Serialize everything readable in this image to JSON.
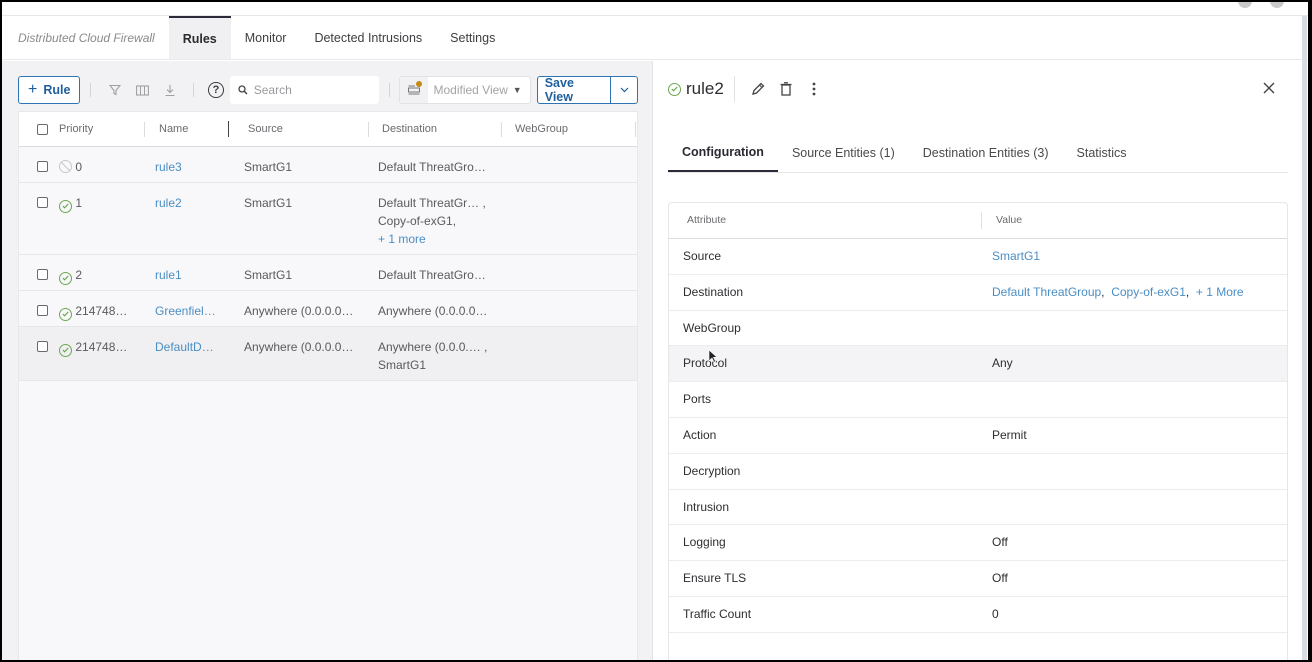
{
  "app": {
    "brand": "Distributed Cloud Firewall",
    "nav_tabs": [
      {
        "label": "Rules",
        "active": true
      },
      {
        "label": "Monitor",
        "active": false
      },
      {
        "label": "Detected Intrusions",
        "active": false
      },
      {
        "label": "Settings",
        "active": false
      }
    ]
  },
  "toolbar": {
    "add_rule_label": "Rule",
    "search_placeholder": "Search",
    "view_select_value": "Modified View",
    "save_view_label": "Save View",
    "icons": [
      "filter-icon",
      "columns-icon",
      "download-icon",
      "help-icon"
    ]
  },
  "rules_table": {
    "columns": [
      "Priority",
      "Name",
      "Source",
      "Destination",
      "WebGroup"
    ],
    "rows": [
      {
        "status": "disabled",
        "priority": "0",
        "name": "rule3",
        "source": "SmartG1",
        "destination": [
          "Default ThreatGro…"
        ],
        "more": "",
        "webgroup": ""
      },
      {
        "status": "enabled",
        "priority": "1",
        "name": "rule2",
        "source": "SmartG1",
        "destination": [
          "Default ThreatGr… ,",
          "Copy-of-exG1,"
        ],
        "more": "+ 1 more",
        "webgroup": ""
      },
      {
        "status": "enabled",
        "priority": "2",
        "name": "rule1",
        "source": "SmartG1",
        "destination": [
          "Default ThreatGro…"
        ],
        "more": "",
        "webgroup": ""
      },
      {
        "status": "enabled",
        "priority": "214748…",
        "name": "Greenfiel…",
        "source": "Anywhere (0.0.0.0…",
        "destination": [
          "Anywhere (0.0.0.0…"
        ],
        "more": "",
        "webgroup": ""
      },
      {
        "status": "enabled",
        "priority": "214748…",
        "name": "DefaultD…",
        "source": "Anywhere (0.0.0.0…",
        "destination": [
          "Anywhere (0.0.0.… ,",
          "SmartG1"
        ],
        "more": "",
        "webgroup": ""
      }
    ]
  },
  "detail": {
    "title": "rule2",
    "status": "enabled",
    "tabs": [
      {
        "label": "Configuration",
        "active": true
      },
      {
        "label": "Source Entities (1)",
        "active": false
      },
      {
        "label": "Destination Entities (3)",
        "active": false
      },
      {
        "label": "Statistics",
        "active": false
      }
    ],
    "attr_header": {
      "attribute": "Attribute",
      "value": "Value"
    },
    "attributes": [
      {
        "key": "Source",
        "value": "SmartG1",
        "links": [
          "SmartG1"
        ]
      },
      {
        "key": "Destination",
        "value": "",
        "links": [
          "Default ThreatGroup",
          "Copy-of-exG1",
          "+ 1 More"
        ]
      },
      {
        "key": "WebGroup",
        "value": ""
      },
      {
        "key": "Protocol",
        "value": "Any"
      },
      {
        "key": "Ports",
        "value": ""
      },
      {
        "key": "Action",
        "value": "Permit"
      },
      {
        "key": "Decryption",
        "value": ""
      },
      {
        "key": "Intrusion",
        "value": ""
      },
      {
        "key": "Logging",
        "value": "Off"
      },
      {
        "key": "Ensure TLS",
        "value": "Off"
      },
      {
        "key": "Traffic Count",
        "value": "0"
      }
    ]
  },
  "colors": {
    "accent": "#2e74b5",
    "link": "#4a8ec4",
    "status_ok": "#6aa84f",
    "badge": "#c28a16"
  }
}
